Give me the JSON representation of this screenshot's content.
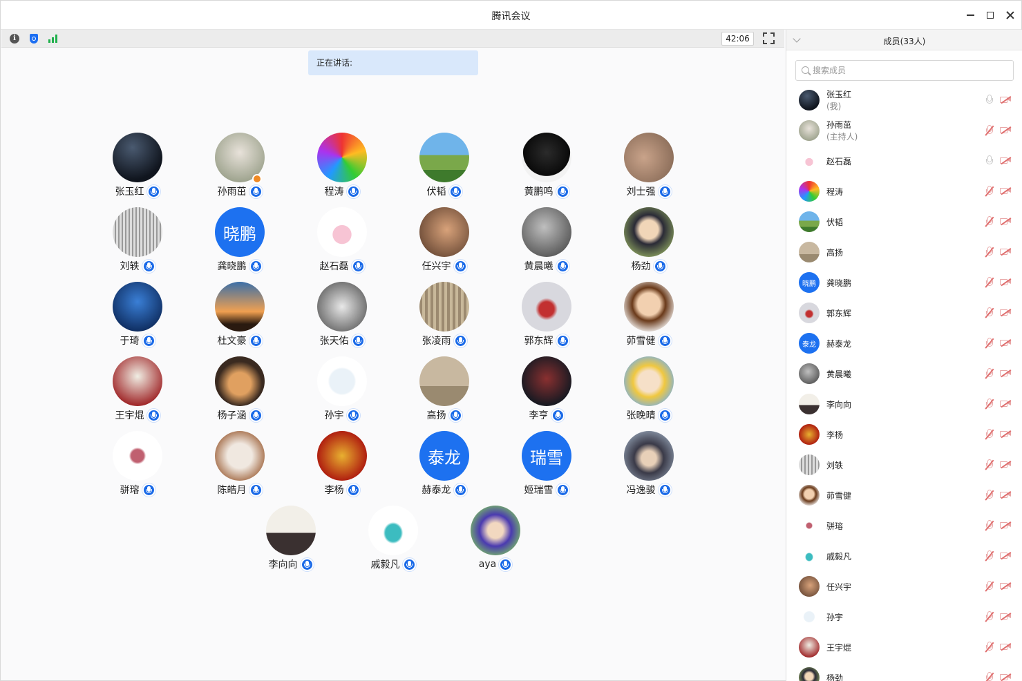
{
  "window": {
    "title": "腾讯会议"
  },
  "toolbar": {
    "timer": "42:06"
  },
  "speaking": {
    "label": "正在讲话:"
  },
  "participants": [
    {
      "name": "张玉红",
      "bg": "radial-gradient(circle at 40% 30%, #4a5a70, #10151e 70%)"
    },
    {
      "name": "孙雨茁",
      "bg": "radial-gradient(circle at 50% 40%, #e8e2da, #9aa08a 80%)",
      "host": true
    },
    {
      "name": "程涛",
      "bg": "conic-gradient(#e33, #fb2, #3c3, #29f, #a3e, #e33)"
    },
    {
      "name": "伏韬",
      "bg": "linear-gradient(#6fb4ea 0 45%, #7aa84a 45% 75%, #3e7a2c 75%)"
    },
    {
      "name": "黄鹏鸣",
      "bg": "radial-gradient(circle at 50% 40%, #2b2b2b, #0a0a0a 60%, #f2f2f2 61%)"
    },
    {
      "name": "刘士强",
      "bg": "radial-gradient(circle at 40% 50%, #c9a38a, #8c6e5a 80%)"
    },
    {
      "name": "刘轶",
      "bg": "repeating-linear-gradient(90deg, #ddd 0 3px, #999 3px 5px)"
    },
    {
      "name": "龚晓鹏",
      "text": "晓鹏"
    },
    {
      "name": "赵石磊",
      "bg": "radial-gradient(circle at 50% 55%, #f7c4d4 0 25%, #ffffff 26%)"
    },
    {
      "name": "任兴宇",
      "bg": "radial-gradient(circle at 55% 45%, #d8a27a, #6b4a36 80%)"
    },
    {
      "name": "黄晨曦",
      "bg": "radial-gradient(circle at 45% 40%, #bfbfbf, #555 80%)"
    },
    {
      "name": "杨劲",
      "bg": "radial-gradient(circle at 50% 45%, #f1d6b8 0 25%, #2a2a36 40%, #8aa05e 80%)"
    },
    {
      "name": "于琦",
      "bg": "radial-gradient(circle at 50% 40%, #3a7fd6, #0d2a5c 80%)"
    },
    {
      "name": "杜文豪",
      "bg": "linear-gradient(#3b6fa8 0%, #f0a050 60%, #2a1a10 85%)"
    },
    {
      "name": "张天佑",
      "bg": "radial-gradient(circle at 50% 50%, #e8e8e8, #666 80%)"
    },
    {
      "name": "张凌雨",
      "bg": "repeating-linear-gradient(90deg, #9c8a70 0 4px, #c8b89a 4px 8px)"
    },
    {
      "name": "郭东辉",
      "bg": "radial-gradient(circle at 50% 55%, #c23030 0 20%, #d8d8de 30%)"
    },
    {
      "name": "茆雪健",
      "bg": "radial-gradient(circle at 50% 45%, #f2d0b0 0 30%, #6a3a1a 45%, #fafafa 80%)"
    },
    {
      "name": "王宇焜",
      "bg": "radial-gradient(circle at 50% 40%, #f0eee4, #a0282a 75%)"
    },
    {
      "name": "杨子涵",
      "bg": "radial-gradient(circle at 50% 55%, #e0a060 0 30%, #3a2a20 60%)"
    },
    {
      "name": "孙宇",
      "bg": "radial-gradient(circle at 50% 50%, #eaf2f8 0 35%, #ffffff 40%)"
    },
    {
      "name": "高扬",
      "bg": "linear-gradient(#c8b8a0 0 60%, #9a8a70 60%)"
    },
    {
      "name": "李亨",
      "bg": "radial-gradient(circle at 50% 45%, #8a3030, #1a1a22 70%)"
    },
    {
      "name": "张晚晴",
      "bg": "radial-gradient(circle at 50% 50%, #f6e0c8 0 30%, #f0c840 45%, #7ab0e0 80%)"
    },
    {
      "name": "骈瑢",
      "bg": "radial-gradient(circle at 50% 50%, #c06070 0 18%, #ffffff 24%)"
    },
    {
      "name": "陈皓月",
      "bg": "radial-gradient(circle at 50% 50%, #f0e8e0 0 35%, #b08060 70%)"
    },
    {
      "name": "李杨",
      "bg": "radial-gradient(circle at 50% 50%, #e8b030, #b02010 70%)"
    },
    {
      "name": "赫泰龙",
      "text": "泰龙"
    },
    {
      "name": "姬瑞雪",
      "text": "瑞雪"
    },
    {
      "name": "冯逸骏",
      "bg": "radial-gradient(circle at 50% 55%, #e8d0b8 0 20%, #3a3a48 40%, #8a96a8 80%)"
    },
    {
      "name": "李向向",
      "bg": "linear-gradient(#f2efe8 0 55%, #3a3030 55%)"
    },
    {
      "name": "戚毅凡",
      "bg": "radial-gradient(ellipse at 50% 55%, #3cbcc0 0 22%, #ffffff 28%)"
    },
    {
      "name": "aya",
      "bg": "radial-gradient(circle at 50% 50%, #f2d8c0 0 22%, #4a3ab0 45%, #7ac060 80%)"
    }
  ],
  "sidebar": {
    "title": "成员(33人)",
    "search_placeholder": "搜索成员",
    "members": [
      {
        "name": "张玉红",
        "sub": "(我)",
        "bg": "radial-gradient(circle at 40% 30%, #4a5a70, #10151e 70%)",
        "muted": false
      },
      {
        "name": "孙雨茁",
        "sub": "(主持人)",
        "bg": "radial-gradient(circle at 50% 40%, #e8e2da, #9aa08a 80%)",
        "muted": true
      },
      {
        "name": "赵石磊",
        "bg": "radial-gradient(circle at 50% 55%, #f7c4d4 0 25%, #ffffff 26%)",
        "muted": false
      },
      {
        "name": "程涛",
        "bg": "conic-gradient(#e33, #fb2, #3c3, #29f, #a3e, #e33)",
        "muted": true
      },
      {
        "name": "伏韬",
        "bg": "linear-gradient(#6fb4ea 0 45%, #7aa84a 45% 75%, #3e7a2c 75%)",
        "muted": true
      },
      {
        "name": "高扬",
        "bg": "linear-gradient(#c8b8a0 0 60%, #9a8a70 60%)",
        "muted": true
      },
      {
        "name": "龚晓鹏",
        "text": "晓鹏",
        "muted": true
      },
      {
        "name": "郭东辉",
        "bg": "radial-gradient(circle at 50% 55%, #c23030 0 20%, #d8d8de 30%)",
        "muted": true
      },
      {
        "name": "赫泰龙",
        "text": "泰龙",
        "muted": true
      },
      {
        "name": "黄晨曦",
        "bg": "radial-gradient(circle at 45% 40%, #bfbfbf, #555 80%)",
        "muted": true
      },
      {
        "name": "李向向",
        "bg": "linear-gradient(#f2efe8 0 55%, #3a3030 55%)",
        "muted": true
      },
      {
        "name": "李杨",
        "bg": "radial-gradient(circle at 50% 50%, #e8b030, #b02010 70%)",
        "muted": true
      },
      {
        "name": "刘轶",
        "bg": "repeating-linear-gradient(90deg, #ddd 0 3px, #999 3px 5px)",
        "muted": true
      },
      {
        "name": "茆雪健",
        "bg": "radial-gradient(circle at 50% 45%, #f2d0b0 0 30%, #6a3a1a 45%, #fafafa 80%)",
        "muted": true
      },
      {
        "name": "骈瑢",
        "bg": "radial-gradient(circle at 50% 50%, #c06070 0 18%, #ffffff 24%)",
        "muted": true
      },
      {
        "name": "戚毅凡",
        "bg": "radial-gradient(ellipse at 50% 55%, #3cbcc0 0 22%, #ffffff 28%)",
        "muted": true
      },
      {
        "name": "任兴宇",
        "bg": "radial-gradient(circle at 55% 45%, #d8a27a, #6b4a36 80%)",
        "muted": true
      },
      {
        "name": "孙宇",
        "bg": "radial-gradient(circle at 50% 50%, #eaf2f8 0 35%, #ffffff 40%)",
        "muted": true
      },
      {
        "name": "王宇焜",
        "bg": "radial-gradient(circle at 50% 40%, #f0eee4, #a0282a 75%)",
        "muted": true
      },
      {
        "name": "杨劲",
        "bg": "radial-gradient(circle at 50% 45%, #f1d6b8 0 25%, #2a2a36 40%, #8aa05e 80%)",
        "muted": true
      }
    ]
  }
}
